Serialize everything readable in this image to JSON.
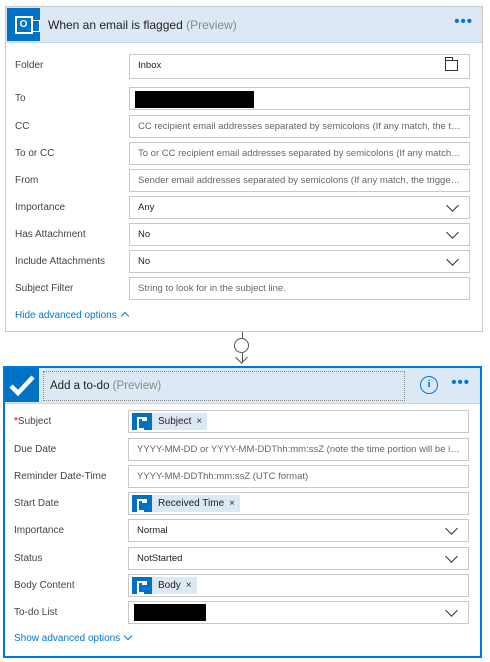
{
  "trigger": {
    "title": "When an email is flagged",
    "preview": "(Preview)",
    "more_label": "•••",
    "fields": {
      "folder": {
        "label": "Folder",
        "value": "Inbox"
      },
      "to": {
        "label": "To"
      },
      "cc": {
        "label": "CC",
        "placeholder": "CC recipient email addresses separated by semicolons (If any match, the trigger will run)"
      },
      "to_or_cc": {
        "label": "To or CC",
        "placeholder": "To or CC recipient email addresses separated by semicolons (If any match, the trigger will run)"
      },
      "from": {
        "label": "From",
        "placeholder": "Sender email addresses separated by semicolons (If any match, the trigger will run)"
      },
      "importance": {
        "label": "Importance",
        "value": "Any"
      },
      "has_attachment": {
        "label": "Has Attachment",
        "value": "No"
      },
      "include_attachments": {
        "label": "Include Attachments",
        "value": "No"
      },
      "subject_filter": {
        "label": "Subject Filter",
        "placeholder": "String to look for in the subject line."
      }
    },
    "advanced_toggle": "Hide advanced options"
  },
  "action": {
    "title": "Add a to-do",
    "preview": "(Preview)",
    "info_label": "i",
    "more_label": "•••",
    "fields": {
      "subject": {
        "label": "Subject",
        "required_mark": "*",
        "token": "Subject",
        "remove": "×"
      },
      "due_date": {
        "label": "Due Date",
        "placeholder": "YYYY-MM-DD or YYYY-MM-DDThh:mm:ssZ (note the time portion will be ignored)"
      },
      "reminder": {
        "label": "Reminder Date-Time",
        "placeholder": "YYYY-MM-DDThh:mm:ssZ (UTC format)"
      },
      "start_date": {
        "label": "Start Date",
        "token": "Received Time",
        "remove": "×"
      },
      "importance": {
        "label": "Importance",
        "value": "Normal"
      },
      "status": {
        "label": "Status",
        "value": "NotStarted"
      },
      "body": {
        "label": "Body Content",
        "token": "Body",
        "remove": "×"
      },
      "todo_list": {
        "label": "To-do List"
      }
    },
    "advanced_toggle": "Show advanced options"
  },
  "colors": {
    "accent": "#0078d7",
    "header_bg": "#dce8f4",
    "icon_bg": "#0072c6"
  }
}
